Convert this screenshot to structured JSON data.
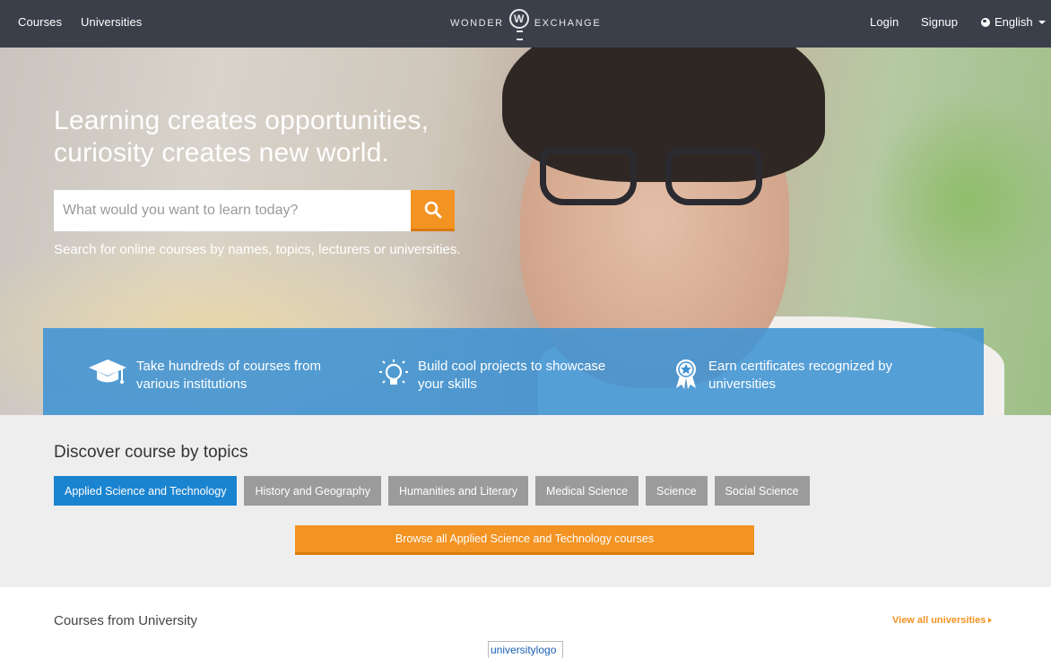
{
  "nav": {
    "left_links": [
      "Courses",
      "Universities"
    ],
    "brand_left": "WONDER",
    "brand_mark": "W",
    "brand_right": "EXCHANGE",
    "login": "Login",
    "signup": "Signup",
    "language": "English"
  },
  "hero": {
    "headline_line1": "Learning creates opportunities,",
    "headline_line2": "curiosity creates new world.",
    "search_placeholder": "What would you want to learn today?",
    "hint": "Search for online courses by names, topics, lecturers or universities."
  },
  "features": [
    {
      "icon": "graduation-cap-icon",
      "line1": "Take hundreds of courses from",
      "line2": "various institutions"
    },
    {
      "icon": "lightbulb-icon",
      "line1": "Build cool projects to showcase",
      "line2": "your skills"
    },
    {
      "icon": "award-ribbon-icon",
      "line1": "Earn certificates recognized by",
      "line2": "universities"
    }
  ],
  "topics": {
    "title": "Discover course by topics",
    "items": [
      "Applied Science and Technology",
      "History and Geography",
      "Humanities and Literary",
      "Medical Science",
      "Science",
      "Social Science"
    ],
    "active_index": 0,
    "browse_label": "Browse all Applied Science and Technology courses"
  },
  "universities": {
    "title": "Courses from University",
    "view_all": "View all universities",
    "logo_alt": "universitylogo"
  },
  "colors": {
    "nav_bg": "#3b3f4a",
    "accent_orange": "#f39322",
    "active_blue": "#1b84d0",
    "features_blue": "#3f93d4"
  }
}
